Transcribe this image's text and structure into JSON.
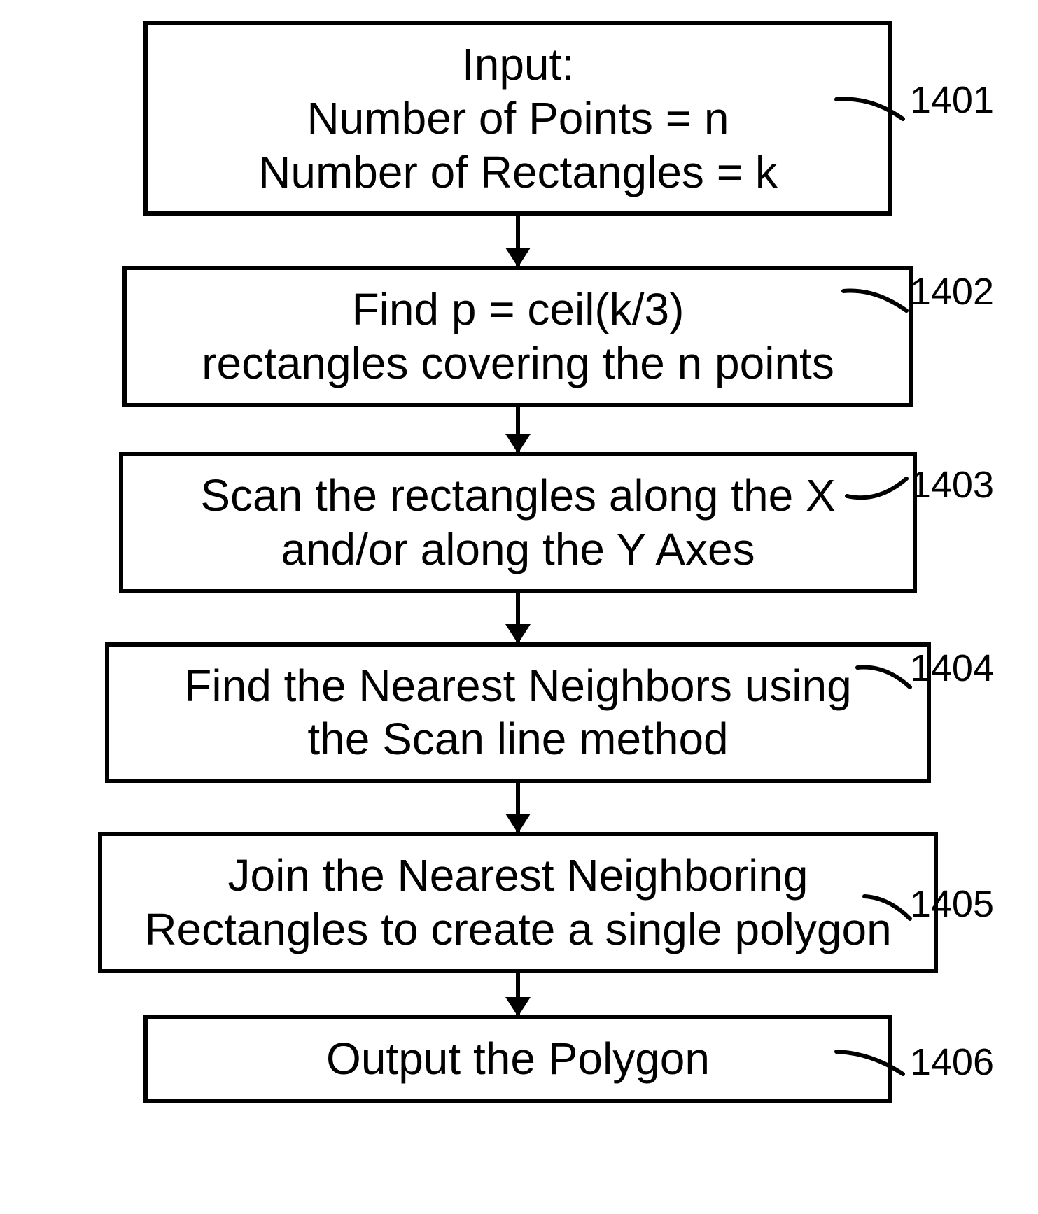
{
  "flowchart": {
    "nodes": [
      {
        "ref": "1401",
        "lines": [
          "Input:",
          "Number of Points = n",
          "Number of Rectangles = k"
        ]
      },
      {
        "ref": "1402",
        "lines": [
          "Find p = ceil(k/3)",
          "rectangles covering the n points"
        ]
      },
      {
        "ref": "1403",
        "lines": [
          "Scan the rectangles along the X",
          "and/or along the Y Axes"
        ]
      },
      {
        "ref": "1404",
        "lines": [
          "Find the Nearest Neighbors using",
          "the Scan line method"
        ]
      },
      {
        "ref": "1405",
        "lines": [
          "Join the Nearest Neighboring",
          "Rectangles to create a single polygon"
        ]
      },
      {
        "ref": "1406",
        "lines": [
          "Output the Polygon"
        ]
      }
    ]
  }
}
